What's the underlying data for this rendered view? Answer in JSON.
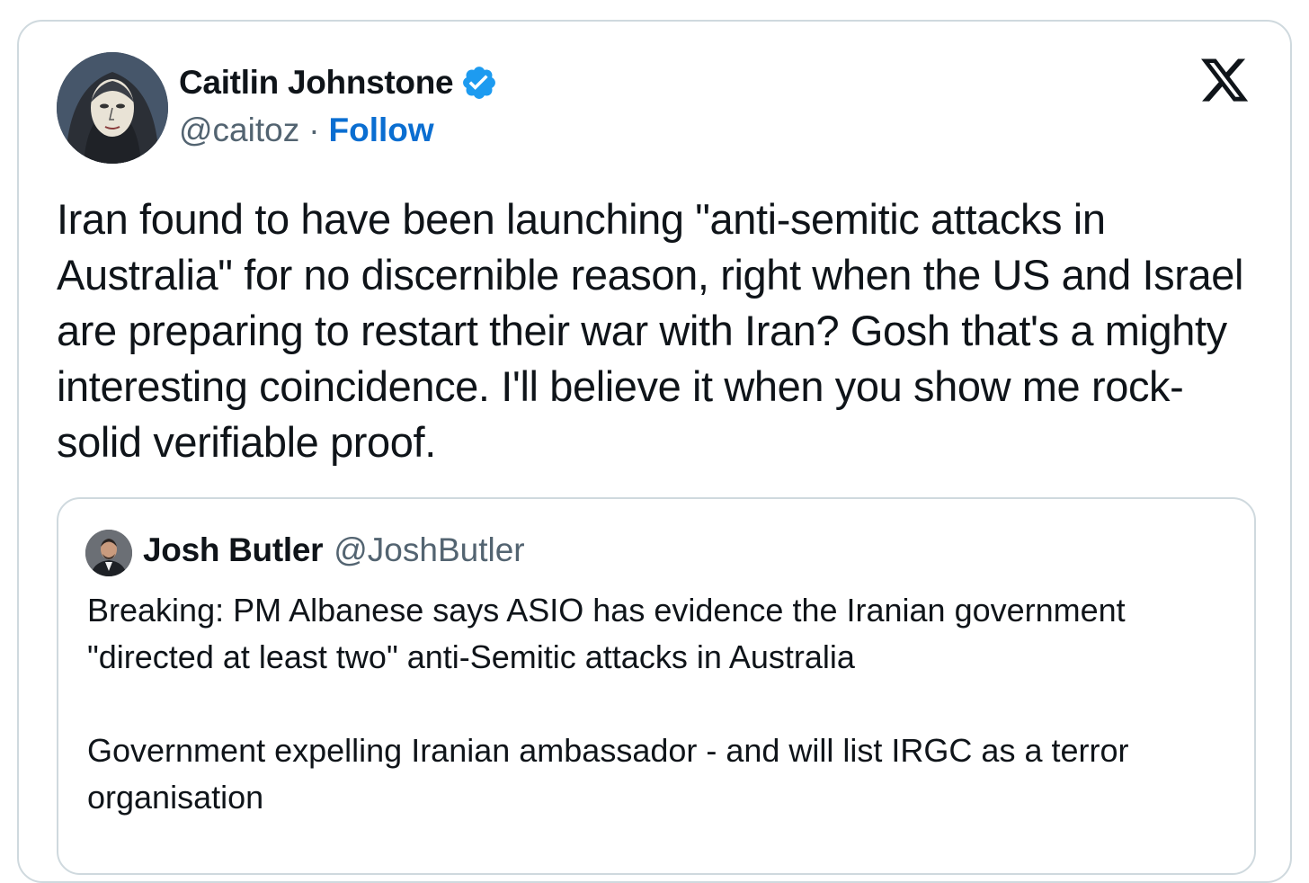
{
  "tweet": {
    "author_name": "Caitlin Johnstone",
    "author_handle": "@caitoz",
    "separator": "·",
    "follow_label": "Follow",
    "verified": true,
    "logo_icon": "x-logo-icon",
    "text": "Iran found to have been launching \"anti-semitic attacks in Australia\" for no discernible reason, right when the US and Israel are preparing to restart their war with Iran? Gosh that's a mighty interesting coincidence. I'll believe it when you show me rock-solid verifiable proof."
  },
  "quoted_tweet": {
    "author_name": "Josh Butler",
    "author_handle": "@JoshButler",
    "paragraph_1": "Breaking: PM Albanese says ASIO has evidence the Iranian government \"directed at least two\" anti-Semitic attacks in Australia",
    "paragraph_2": "Government expelling Iranian ambassador - and will list IRGC as a terror organisation"
  },
  "colors": {
    "border": "#cfd9de",
    "link_blue": "#0a6ed1",
    "verified_blue": "#1d9bf0",
    "muted_text": "#536471",
    "text": "#0f1419"
  }
}
